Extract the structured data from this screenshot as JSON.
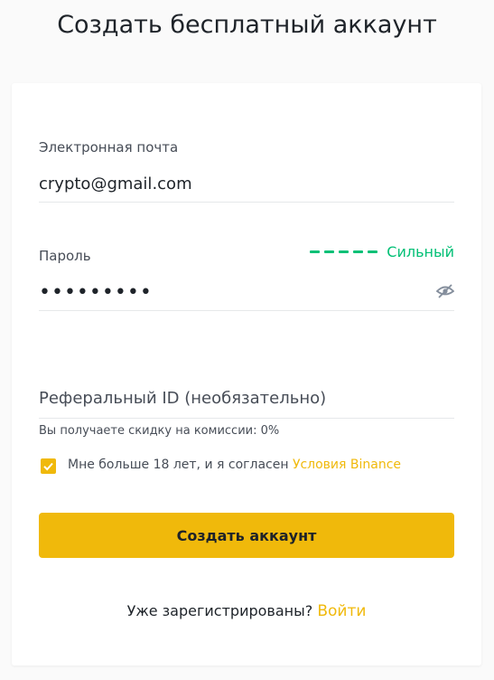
{
  "page": {
    "title": "Создать бесплатный аккаунт"
  },
  "form": {
    "email": {
      "label": "Электронная почта",
      "value": "crypto@gmail.com"
    },
    "password": {
      "label": "Пароль",
      "value": "•••••••••",
      "strength_label": "Сильный",
      "strength_bars": 5,
      "visibility_icon": "eye-slash-icon"
    },
    "referral": {
      "placeholder": "Реферальный ID (необязательно)",
      "discount_note": "Вы получаете скидку на комиссии: 0%"
    },
    "agreement": {
      "checked": true,
      "text": "Мне больше 18 лет, и я согласен",
      "link_text": "Условия Binance"
    },
    "submit_label": "Создать аккаунт",
    "login": {
      "prompt": "Уже зарегистрированы?",
      "link_text": "Войти"
    }
  },
  "colors": {
    "accent": "#f0b90b",
    "strength": "#02c076",
    "text_primary": "#1e2329",
    "text_secondary": "#474d57"
  }
}
